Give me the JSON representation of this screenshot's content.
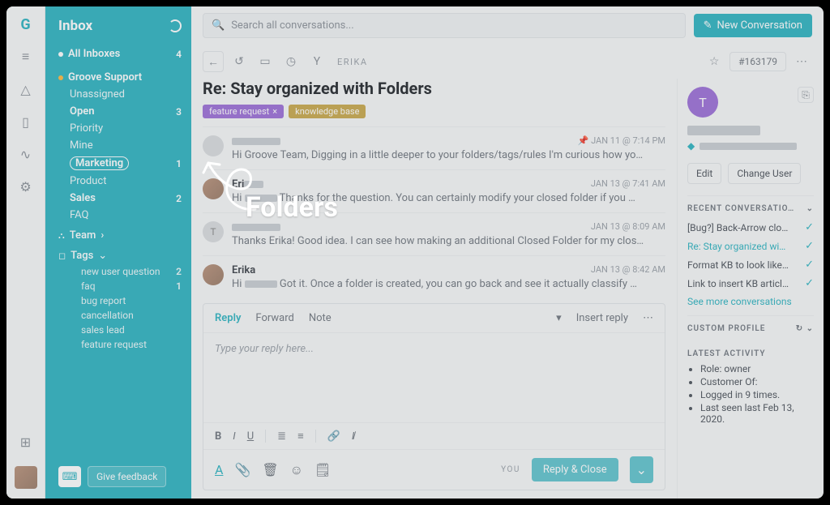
{
  "sidebar": {
    "title": "Inbox",
    "all_inboxes": {
      "label": "All Inboxes",
      "count": "4"
    },
    "mailbox": {
      "label": "Groove Support"
    },
    "folders": [
      {
        "label": "Unassigned",
        "count": ""
      },
      {
        "label": "Open",
        "count": "3"
      },
      {
        "label": "Priority",
        "count": ""
      },
      {
        "label": "Mine",
        "count": ""
      },
      {
        "label": "Marketing",
        "count": "1"
      },
      {
        "label": "Product",
        "count": ""
      },
      {
        "label": "Sales",
        "count": "2"
      },
      {
        "label": "FAQ",
        "count": ""
      }
    ],
    "team_label": "Team",
    "tags_label": "Tags",
    "tags": [
      {
        "label": "new user question",
        "count": "2"
      },
      {
        "label": "faq",
        "count": "1"
      },
      {
        "label": "bug report",
        "count": ""
      },
      {
        "label": "cancellation",
        "count": ""
      },
      {
        "label": "sales lead",
        "count": ""
      },
      {
        "label": "feature request",
        "count": ""
      }
    ],
    "feedback": "Give feedback"
  },
  "search": {
    "placeholder": "Search all conversations..."
  },
  "new_conversation": "New Conversation",
  "toolbar": {
    "assignee": "ERIKA",
    "ticket_id": "#163179"
  },
  "thread": {
    "title": "Re: Stay organized with Folders",
    "tags": [
      {
        "label": "feature request",
        "color": "purple"
      },
      {
        "label": "knowledge base",
        "color": "mustard"
      }
    ],
    "messages": [
      {
        "author": "",
        "time": "JAN 11 @ 7:14 PM",
        "snippet": "Hi Groove Team, Digging in a little deeper to your folders/tags/rules I'm curious how yo…",
        "pinned": true
      },
      {
        "author": "Eri",
        "time": "JAN 13 @ 7:41 AM",
        "snippet": "Thanks for the question. You can certainly modify your closed folder if you …",
        "prefix": "Hi"
      },
      {
        "author": "T",
        "time": "JAN 13 @ 8:09 AM",
        "snippet": "Thanks Erika! Good idea.  I can see how making an additional Closed Folder for my clos…"
      },
      {
        "author": "Erika",
        "time": "JAN 13 @ 8:42 AM",
        "snippet": "Got it. Once a folder is created, you can go back and see it actually classify …",
        "prefix": "Hi"
      }
    ]
  },
  "composer": {
    "tabs": {
      "reply": "Reply",
      "forward": "Forward",
      "note": "Note"
    },
    "insert_reply": "Insert reply",
    "placeholder": "Type your reply here...",
    "you": "YOU",
    "send": "Reply & Close"
  },
  "right_panel": {
    "avatar_initial": "T",
    "edit": "Edit",
    "change_user": "Change User",
    "recent_head": "RECENT CONVERSATIO…",
    "recent": [
      {
        "text": "[Bug?] Back-Arrow clo…",
        "active": false
      },
      {
        "text": "Re: Stay organized wi…",
        "active": true
      },
      {
        "text": "Format KB to look like…",
        "active": false
      },
      {
        "text": "Link to insert KB articl…",
        "active": false
      }
    ],
    "see_more": "See more conversations",
    "custom_profile": "CUSTOM PROFILE",
    "latest_activity": "LATEST ACTIVITY",
    "activity_items": [
      "Role: owner",
      "Customer Of:",
      "Logged in 9 times.",
      "Last seen last Feb 13, 2020."
    ]
  },
  "annotation": {
    "label": "Folders"
  }
}
